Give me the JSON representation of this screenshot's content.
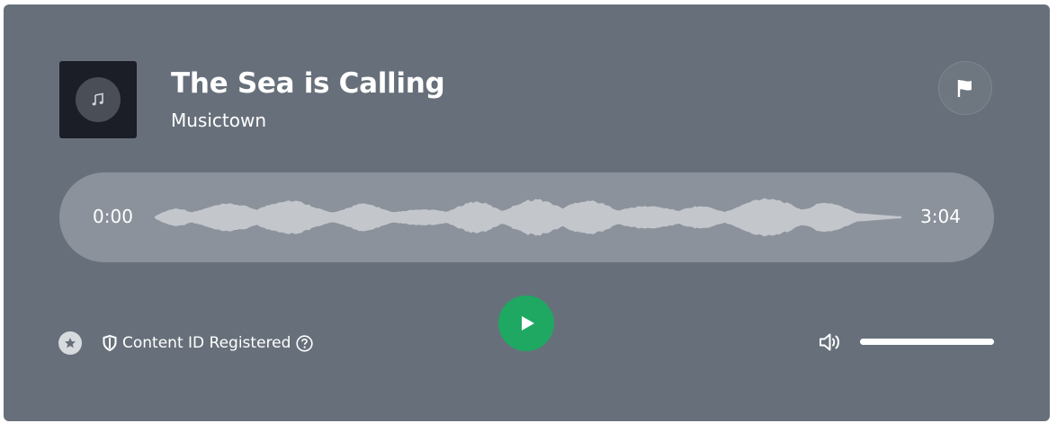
{
  "track": {
    "title": "The Sea is Calling",
    "artist": "Musictown",
    "cover_icon": "music-note-icon"
  },
  "player": {
    "current_time": "0:00",
    "duration": "3:04",
    "play_icon": "play-icon",
    "flag_icon": "flag-icon",
    "volume_icon": "speaker-icon",
    "volume_level": 1.0
  },
  "footer": {
    "favorite_icon": "star-icon",
    "content_id_icon": "shield-icon",
    "content_id_label": "Content ID Registered",
    "help_icon": "question-circle-icon"
  },
  "colors": {
    "card_background": "#67707a",
    "play_button": "#1ea862",
    "waveform_fill": "#c3c6cb",
    "waveform_track": "#8b929b"
  }
}
